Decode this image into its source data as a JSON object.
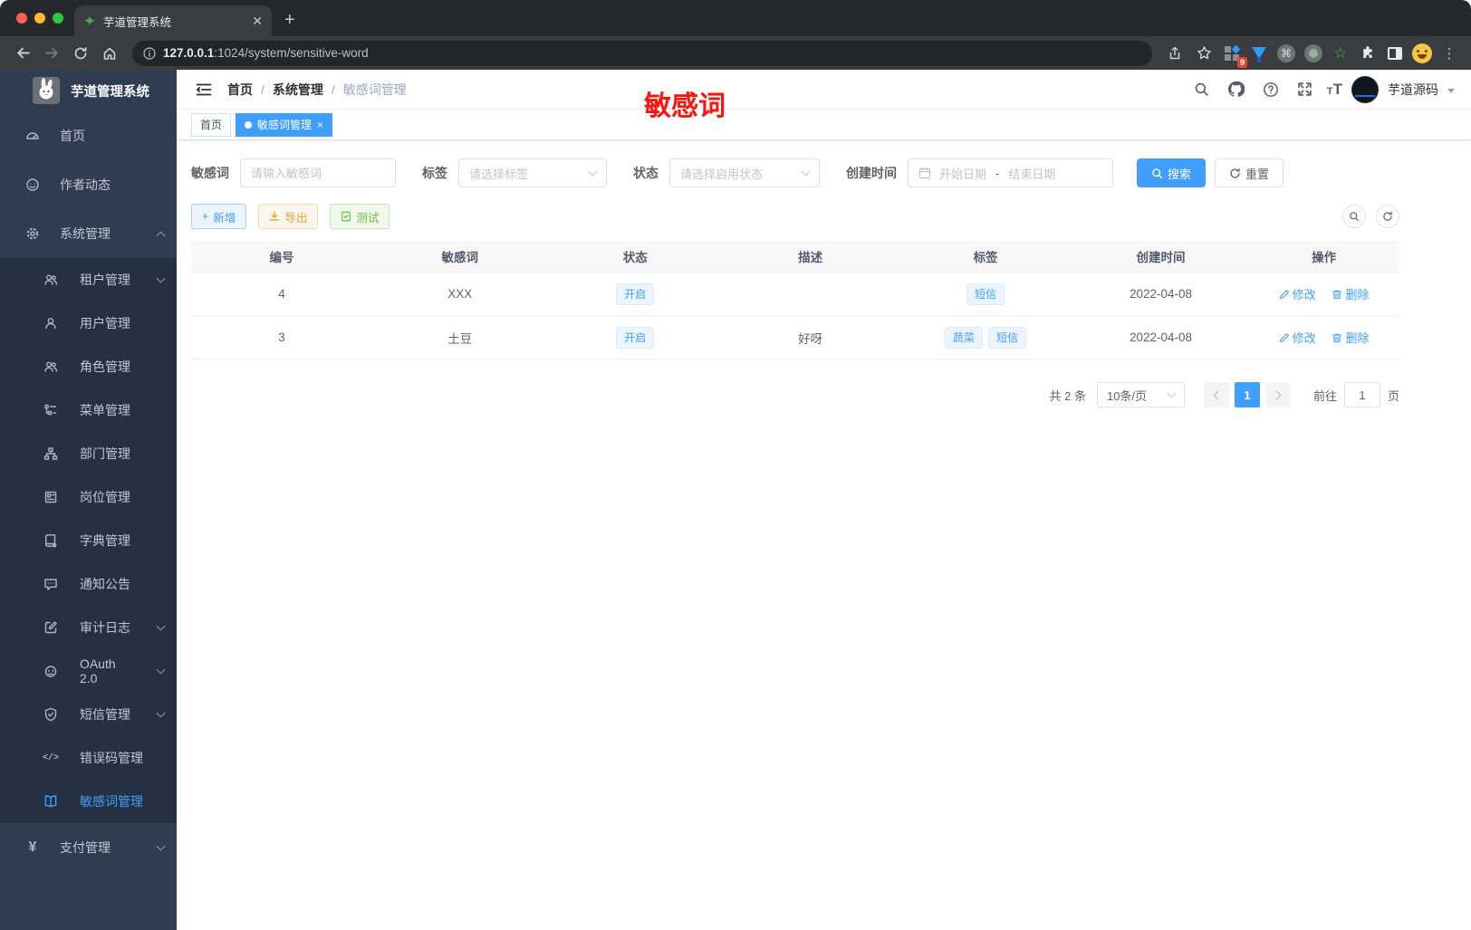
{
  "colors": {
    "accent": "#409eff",
    "annotation_red": "#fb1510",
    "sidebar_bg": "#2f3c52",
    "submenu_bg": "#253143"
  },
  "browser": {
    "tab_title": "芋道管理系统",
    "url_host": "127.0.0.1",
    "url_path": ":1024/system/sensitive-word",
    "ext_badge": "9"
  },
  "sidebar": {
    "app_title": "芋道管理系统",
    "items": [
      {
        "label": "首页"
      },
      {
        "label": "作者动态"
      },
      {
        "label": "系统管理"
      },
      {
        "label": "租户管理"
      },
      {
        "label": "用户管理"
      },
      {
        "label": "角色管理"
      },
      {
        "label": "菜单管理"
      },
      {
        "label": "部门管理"
      },
      {
        "label": "岗位管理"
      },
      {
        "label": "字典管理"
      },
      {
        "label": "通知公告"
      },
      {
        "label": "审计日志"
      },
      {
        "label": "OAuth 2.0"
      },
      {
        "label": "短信管理"
      },
      {
        "label": "错误码管理"
      },
      {
        "label": "敏感词管理"
      },
      {
        "label": "支付管理"
      }
    ]
  },
  "header": {
    "breadcrumb": [
      "首页",
      "系统管理",
      "敏感词管理"
    ],
    "separator": "/",
    "annotation": "敏感词",
    "username": "芋道源码"
  },
  "tags": [
    {
      "label": "首页",
      "active": false
    },
    {
      "label": "敏感词管理",
      "active": true
    }
  ],
  "filters": {
    "keyword_label": "敏感词",
    "keyword_placeholder": "请输入敏感词",
    "tag_label": "标签",
    "tag_placeholder": "请选择标签",
    "status_label": "状态",
    "status_placeholder": "请选择启用状态",
    "date_label": "创建时间",
    "date_start_placeholder": "开始日期",
    "date_separator": "-",
    "date_end_placeholder": "结束日期",
    "search_label": "搜索",
    "reset_label": "重置"
  },
  "toolbar": {
    "add_label": "新增",
    "export_label": "导出",
    "test_label": "测试"
  },
  "table": {
    "columns": [
      "编号",
      "敏感词",
      "状态",
      "描述",
      "标签",
      "创建时间",
      "操作"
    ],
    "edit_label": "修改",
    "delete_label": "删除",
    "rows": [
      {
        "id": "4",
        "word": "XXX",
        "status": "开启",
        "desc": "",
        "tags": [
          "短信"
        ],
        "created": "2022-04-08"
      },
      {
        "id": "3",
        "word": "土豆",
        "status": "开启",
        "desc": "好呀",
        "tags": [
          "蔬菜",
          "短信"
        ],
        "created": "2022-04-08"
      }
    ]
  },
  "pagination": {
    "total": "共 2 条",
    "page_size": "10条/页",
    "current": "1",
    "goto_label": "前往",
    "goto_value": "1",
    "page_label": "页"
  }
}
